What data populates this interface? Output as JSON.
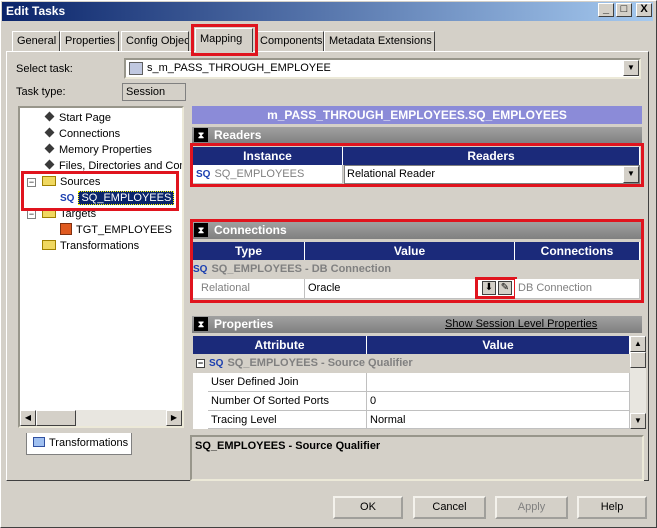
{
  "window": {
    "title": "Edit Tasks",
    "caption_minimize": "_",
    "caption_maximize": "□",
    "caption_close": "X"
  },
  "tabs": [
    {
      "label": "General"
    },
    {
      "label": "Properties"
    },
    {
      "label": "Config Object"
    },
    {
      "label": "Mapping"
    },
    {
      "label": "Components"
    },
    {
      "label": "Metadata Extensions"
    }
  ],
  "select_task": {
    "label": "Select task:",
    "value": "s_m_PASS_THROUGH_EMPLOYEE"
  },
  "task_type": {
    "label": "Task type:",
    "value": "Session"
  },
  "tree": {
    "items": [
      {
        "label": "Start Page"
      },
      {
        "label": "Connections"
      },
      {
        "label": "Memory Properties"
      },
      {
        "label": "Files, Directories and Commands"
      },
      {
        "label": "Sources"
      },
      {
        "label": "SQ_EMPLOYEES"
      },
      {
        "label": "Targets"
      },
      {
        "label": "TGT_EMPLOYEES"
      },
      {
        "label": "Transformations"
      }
    ],
    "sq_tag": "SQ"
  },
  "bottom_tab": {
    "label": "Transformations"
  },
  "main_title": "m_PASS_THROUGH_EMPLOYEES.SQ_EMPLOYEES",
  "readers": {
    "section_label": "Readers",
    "col_instance": "Instance",
    "col_readers": "Readers",
    "instance": "SQ_EMPLOYEES",
    "reader": "Relational Reader"
  },
  "connections": {
    "section_label": "Connections",
    "col_type": "Type",
    "col_value": "Value",
    "col_connections": "Connections",
    "group_label": "SQ_EMPLOYEES - DB Connection",
    "row_type": "Relational",
    "row_value": "Oracle",
    "row_connections": "DB Connection"
  },
  "properties": {
    "section_label": "Properties",
    "link": "Show Session Level Properties",
    "col_attribute": "Attribute",
    "col_value": "Value",
    "group_label": "SQ_EMPLOYEES - Source Qualifier",
    "rows": [
      {
        "attribute": "User Defined Join",
        "value": ""
      },
      {
        "attribute": "Number Of Sorted Ports",
        "value": "0"
      },
      {
        "attribute": "Tracing Level",
        "value": "Normal"
      }
    ]
  },
  "description": "SQ_EMPLOYEES - Source Qualifier",
  "buttons": {
    "ok": "OK",
    "cancel": "Cancel",
    "apply": "Apply",
    "help": "Help"
  },
  "colors": {
    "highlight": "#e0141e",
    "header_blue": "#1b2a7a",
    "title_bar": "#0a246a"
  }
}
